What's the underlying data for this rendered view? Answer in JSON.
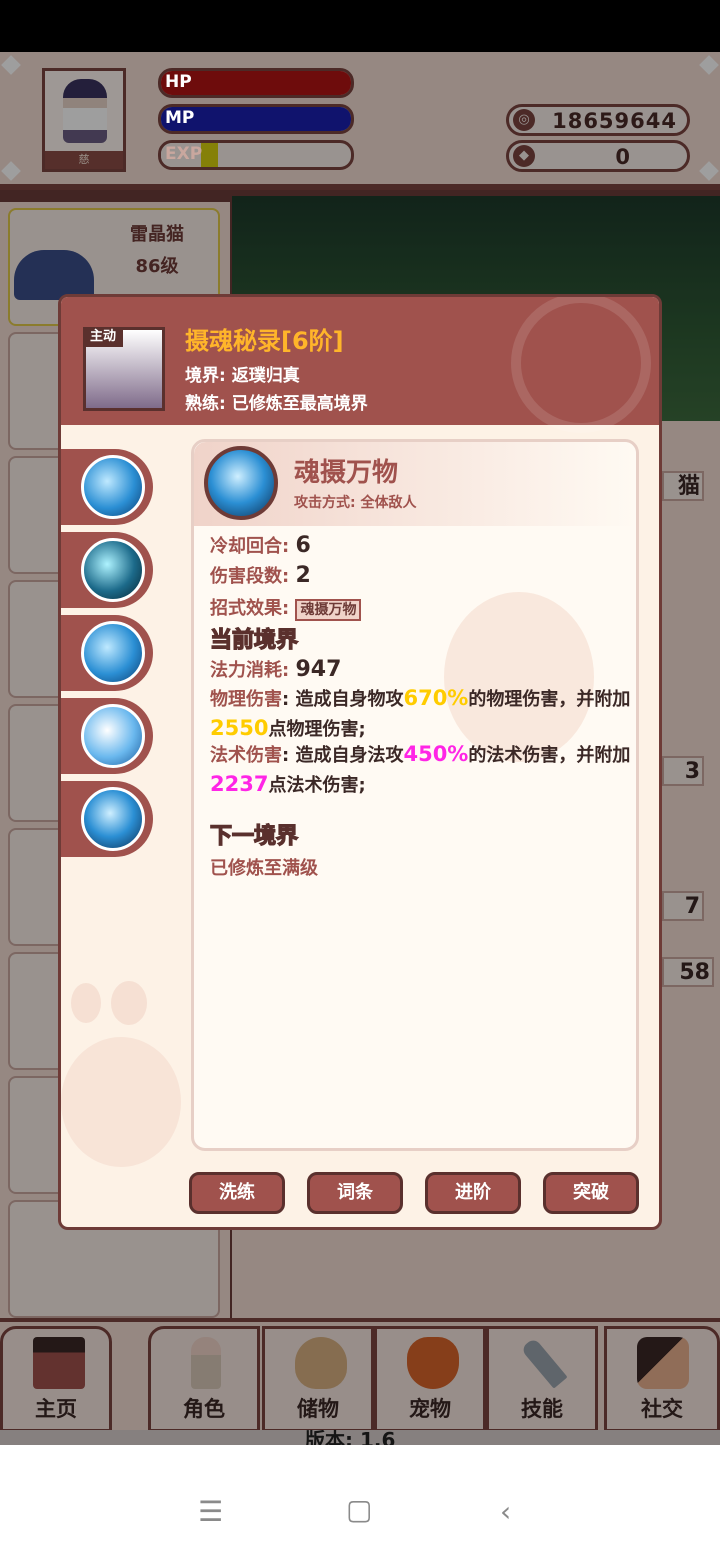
{
  "player": {
    "name": "慈",
    "hp_label": "HP",
    "mp_label": "MP",
    "exp_label": "EXP",
    "hp": 1.0,
    "mp": 1.0,
    "exp": 0.08
  },
  "currency": [
    {
      "icon": "coin-icon",
      "value": "18659644"
    },
    {
      "icon": "gem-icon",
      "value": "0"
    }
  ],
  "pet": {
    "name": "雷晶猫",
    "level": "86级",
    "partial_label": "猫"
  },
  "right_numbers": [
    "3",
    "7",
    "58"
  ],
  "skill": {
    "badge": "主动",
    "title": "摄魂秘录[6阶]",
    "realm": "境界: 返璞归真",
    "mastery": "熟练: 已修炼至最高境界",
    "move_name": "魂摄万物",
    "attack_mode": "攻击方式: 全体敌人",
    "cooldown_label": "冷却回合: ",
    "cooldown": "6",
    "hits_label": "伤害段数: ",
    "hits": "2",
    "effect_label": "招式效果: ",
    "effect_tag": "魂摄万物",
    "current_realm_title": "当前境界",
    "mana_label": "法力消耗: ",
    "mana": "947",
    "phys_label": "物理伤害",
    "phys_text_a": ": 造成自身物攻",
    "phys_pct": "670%",
    "phys_text_b": "的物理伤害，并附加",
    "phys_flat": "2550",
    "phys_text_c": "点物理伤害;",
    "mag_label": "法术伤害",
    "mag_text_a": ": 造成自身法攻",
    "mag_pct": "450%",
    "mag_text_b": "的法术伤害，并附加",
    "mag_flat": "2237",
    "mag_text_c": "点法术伤害;",
    "next_realm_title": "下一境界",
    "next_realm_text": "已修炼至满级"
  },
  "buttons": {
    "refine": "洗练",
    "affix": "词条",
    "advance": "进阶",
    "breakthrough": "突破"
  },
  "nav": [
    {
      "label": "主页",
      "icon": "gate-icon"
    },
    {
      "label": "角色",
      "icon": "character-icon"
    },
    {
      "label": "储物",
      "icon": "bag-icon"
    },
    {
      "label": "宠物",
      "icon": "fox-icon"
    },
    {
      "label": "技能",
      "icon": "sword-icon"
    },
    {
      "label": "社交",
      "icon": "handshake-icon"
    }
  ],
  "version": "版本: 1.6",
  "colors": {
    "accent": "#a0524d",
    "dark": "#5a302d",
    "highlight_yellow": "#ffcc00",
    "highlight_magenta": "#ff25e6",
    "title_orange": "#ffb52a"
  }
}
